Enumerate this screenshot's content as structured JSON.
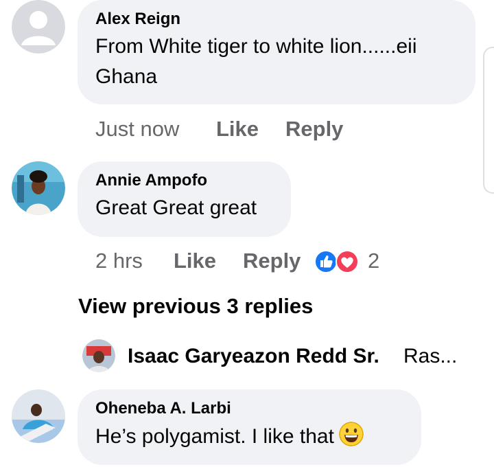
{
  "comments": [
    {
      "author": "Alex Reign",
      "text_line1": "From White tiger to white lion......eii",
      "text_line2": "Ghana",
      "time": "Just now",
      "like": "Like",
      "reply": "Reply"
    },
    {
      "author": "Annie Ampofo",
      "text": "Great Great great",
      "time": "2 hrs",
      "like": "Like",
      "reply": "Reply",
      "reaction_count": "2"
    },
    {
      "author": "Oheneba A. Larbi",
      "text": "He’s polygamist. I like that"
    }
  ],
  "view_previous": "View previous 3 replies",
  "reply_preview": {
    "author": "Isaac Garyeazon Redd Sr.",
    "snippet": "Ras..."
  },
  "colors": {
    "bubble": "#f0f2f5",
    "meta_text": "#65676b",
    "like_blue": "#1877f2",
    "love_red": "#f33e58"
  },
  "icons": [
    "default-avatar-icon",
    "like-reaction-icon",
    "love-reaction-icon",
    "grinning-face-emoji-icon"
  ]
}
